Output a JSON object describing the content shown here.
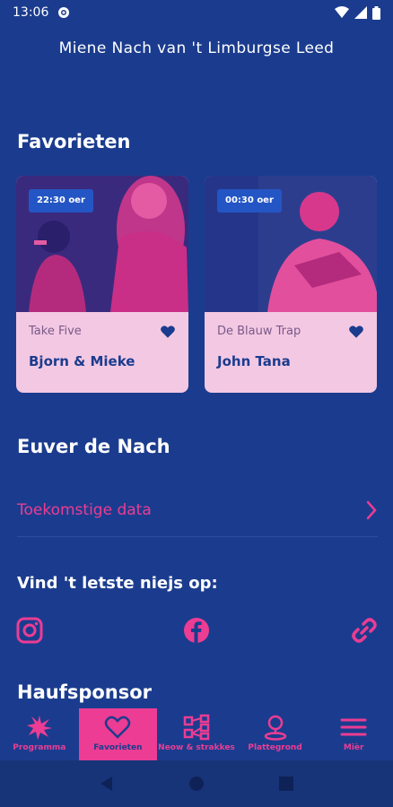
{
  "status_bar": {
    "time": "13:06"
  },
  "header": {
    "title": "Miene Nach van 't Limburgse Leed"
  },
  "favorites": {
    "title": "Favorieten",
    "cards": [
      {
        "time_badge": "22:30 oer",
        "subtitle": "Take Five",
        "performer": "Bjorn & Mieke"
      },
      {
        "time_badge": "00:30 oer",
        "subtitle": "De Blauw Trap",
        "performer": "John Tana"
      }
    ]
  },
  "about": {
    "title": "Euver de Nach",
    "link_label": "Toekomstige data"
  },
  "news": {
    "title": "Vind 't letste niejs op:"
  },
  "sponsor": {
    "title": "Haufsponsor"
  },
  "bottom_nav": {
    "items": [
      {
        "label": "Programma",
        "icon": "program-icon"
      },
      {
        "label": "Favorieten",
        "icon": "heart-icon"
      },
      {
        "label": "Neow & strakkes",
        "icon": "list-icon"
      },
      {
        "label": "Plattegrond",
        "icon": "map-pin-icon"
      },
      {
        "label": "Mièr",
        "icon": "menu-icon"
      }
    ],
    "active_index": 1
  },
  "colors": {
    "background": "#1b3c8e",
    "accent": "#ec3c93",
    "card": "#f3c8e3",
    "badge": "#2455c4"
  }
}
